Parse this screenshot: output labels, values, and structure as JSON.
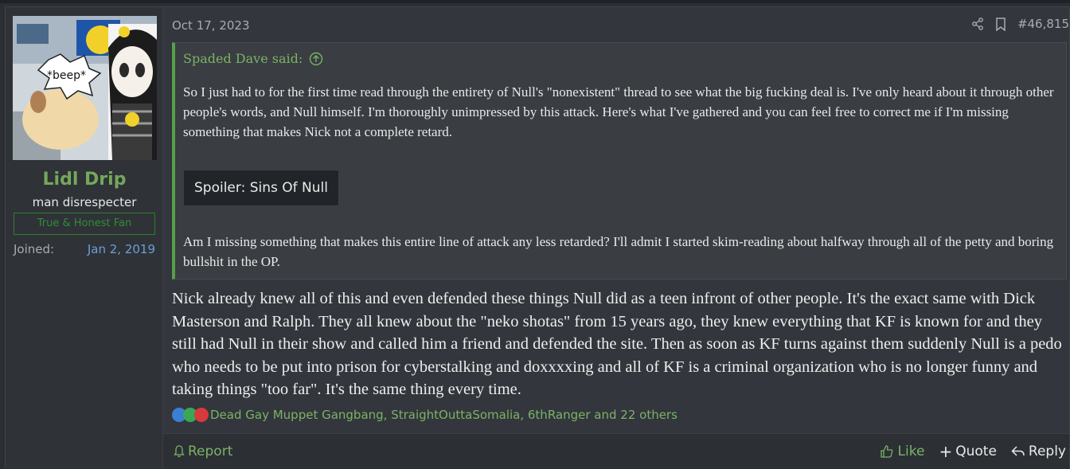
{
  "post": {
    "date": "Oct 17, 2023",
    "number": "#46,815",
    "user": {
      "username": "Lidl Drip",
      "title": "man disrespecter",
      "banner": "True & Honest Fan",
      "joined_label": "Joined:",
      "joined_value": "Jan 2, 2019",
      "avatar_text": "*beep*"
    },
    "quote": {
      "attribution": "Spaded Dave said:",
      "body": "So I just had to for the first time read through the entirety of Null's \"nonexistent\" thread to see what the big fucking deal is. I've only heard about it through other people's words, and Null himself. I'm thoroughly unimpressed by this attack. Here's what I've gathered and you can feel free to correct me if I'm missing something that makes Nick not a complete retard.",
      "spoiler_label": "Spoiler: Sins Of Null",
      "tail": "Am I missing something that makes this entire line of attack any less retarded? I'll admit I started skim-reading about halfway through all of the petty and boring bullshit in the OP."
    },
    "message": "Nick already knew all of this and even defended these things Null did as a teen infront of other people. It's the exact same with Dick Masterson and Ralph. They all knew about the \"neko shotas\" from 15 years ago, they knew everything that KF is known for and they still had Null in their show and called him a friend and defended the site. Then as soon as KF turns against them suddenly Null is a pedo who needs to be put into prison for cyberstalking and doxxxxing and all of KF is a criminal organization who is no longer funny and taking things \"too far\". It's the same thing every time.",
    "reactions": {
      "text": "Dead Gay Muppet Gangbang, StraightOuttaSomalia, 6thRanger and 22 others",
      "icons": [
        "thumbs-up-icon",
        "check-icon",
        "heart-icon"
      ],
      "colors": [
        "#3b7fd4",
        "#3aa757",
        "#d63a3a"
      ]
    },
    "footer": {
      "report": "Report",
      "like": "Like",
      "quote": "Quote",
      "reply": "Reply"
    }
  },
  "colors": {
    "accent_green": "#7ab366",
    "link_blue": "#6aa0d8",
    "background": "#2b2e33"
  }
}
